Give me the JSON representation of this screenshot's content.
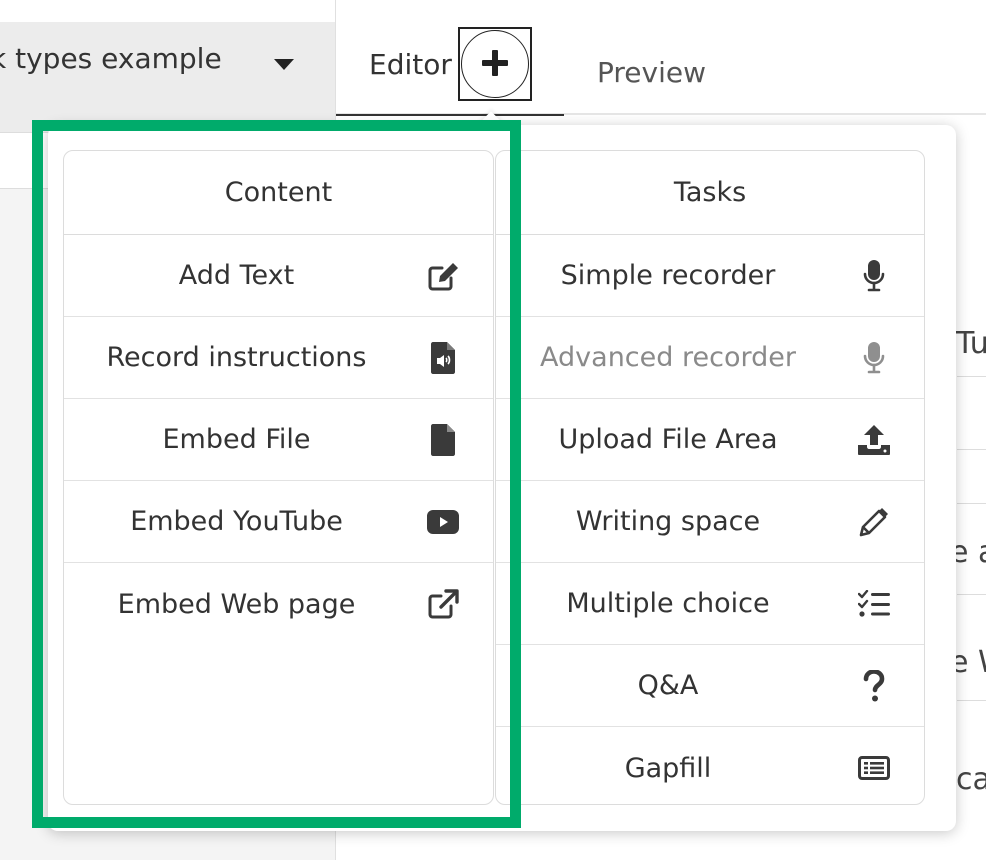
{
  "dropdown": {
    "text": "k types example",
    "caret_icon": "caret-down-icon"
  },
  "tabs": {
    "editor_label": "Editor",
    "add_icon": "plus-icon",
    "preview_label": "Preview"
  },
  "background_edge": {
    "t1": "Tul",
    "t2": "e at",
    "t3": "e W",
    "t4": "ca"
  },
  "content_panel": {
    "title": "Content",
    "items": [
      {
        "label": "Add Text",
        "icon": "edit-icon"
      },
      {
        "label": "Record instructions",
        "icon": "audio-file-icon"
      },
      {
        "label": "Embed File",
        "icon": "file-icon"
      },
      {
        "label": "Embed YouTube",
        "icon": "youtube-icon"
      },
      {
        "label": "Embed Web page",
        "icon": "external-link-icon"
      }
    ]
  },
  "tasks_panel": {
    "title": "Tasks",
    "items": [
      {
        "label": "Simple recorder",
        "icon": "microphone-icon"
      },
      {
        "label": "Advanced recorder",
        "icon": "microphone-icon",
        "disabled": true
      },
      {
        "label": "Upload File Area",
        "icon": "upload-icon"
      },
      {
        "label": "Writing space",
        "icon": "pencil-icon"
      },
      {
        "label": "Multiple choice",
        "icon": "checklist-icon"
      },
      {
        "label": "Q&A",
        "icon": "question-icon"
      },
      {
        "label": "Gapfill",
        "icon": "gapfill-icon"
      }
    ]
  },
  "colors": {
    "highlight": "#00ab6b",
    "icon": "#3a3a3a",
    "icon_disabled": "#8f8f8f"
  }
}
